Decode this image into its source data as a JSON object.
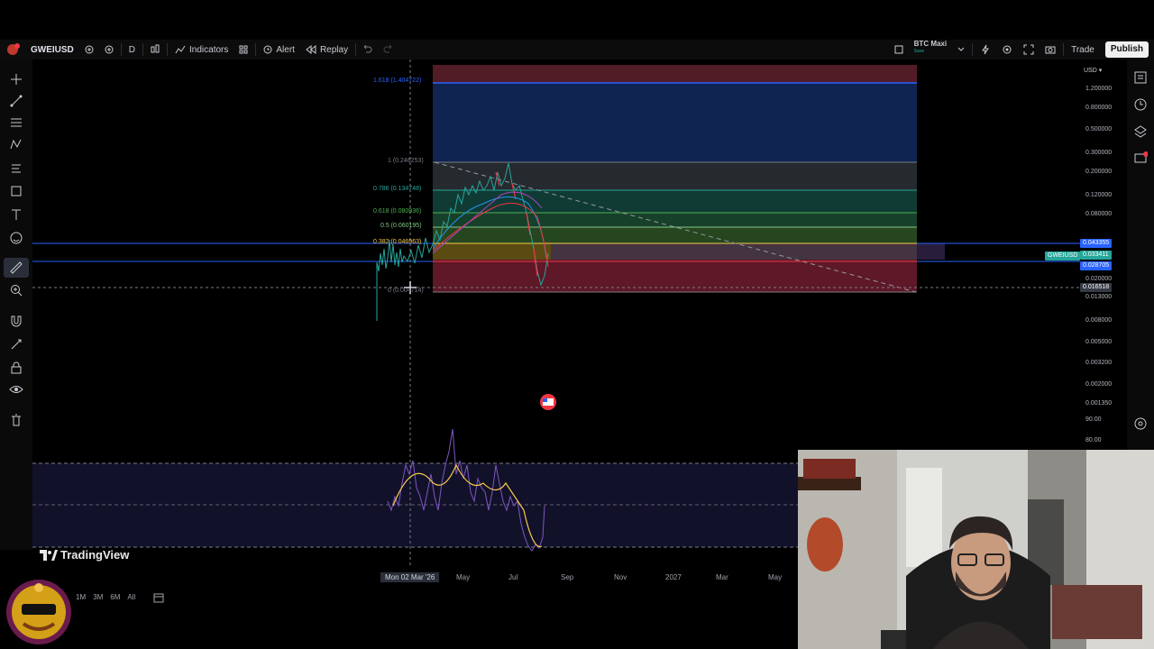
{
  "toolbar": {
    "symbol": "GWEIUSD",
    "interval": "D",
    "indicators_label": "Indicators",
    "alert_label": "Alert",
    "replay_label": "Replay",
    "layout_name": "BTC Maxi",
    "layout_sub": "Save",
    "trade_label": "Trade",
    "publish_label": "Publish"
  },
  "price_scale": {
    "currency": "USD",
    "ticks": [
      "1.200000",
      "0.800000",
      "0.500000",
      "0.300000",
      "0.200000",
      "0.120000",
      "0.080000",
      "0.020000",
      "0.013000",
      "0.008000",
      "0.005000",
      "0.003200",
      "0.002000",
      "0.001350"
    ],
    "tags": [
      {
        "value": "0.043355",
        "color": "#2962ff"
      },
      {
        "value": "0.033411",
        "color": "#26a69a"
      },
      {
        "value": "0.028705",
        "color": "#2962ff"
      },
      {
        "value": "0.016518",
        "color": "#363a45"
      }
    ],
    "symbol_tag": "GWEIUSD"
  },
  "fib": {
    "levels": [
      {
        "label": "1.618 (1.404722)",
        "color": "#2962ff"
      },
      {
        "label": "1 (0.246253)",
        "color": "#787b86"
      },
      {
        "label": "0.786 (0.134748)",
        "color": "#26a69a"
      },
      {
        "label": "0.618 (0.080936)",
        "color": "#4caf50"
      },
      {
        "label": "0.5 (0.060195)",
        "color": "#81c784"
      },
      {
        "label": "0.382 (0.046963)",
        "color": "#f7c948"
      },
      {
        "label": "0 (0.004714)",
        "color": "#787b86"
      }
    ]
  },
  "osc_scale": {
    "ticks": [
      "90.00",
      "80.00"
    ]
  },
  "time_axis": {
    "cursor_label": "Mon 02 Mar '26",
    "labels": [
      "May",
      "Jul",
      "Sep",
      "Nov",
      "2027",
      "Mar",
      "May"
    ]
  },
  "bottom_bar": {
    "ranges": [
      "1M",
      "3M",
      "6M",
      "All"
    ]
  },
  "watermark": "TradingView",
  "colors": {
    "background": "#000000",
    "accent": "#2962ff",
    "fib_upper": "#1e3a6e",
    "fib_lower": "#7a1a2a"
  }
}
